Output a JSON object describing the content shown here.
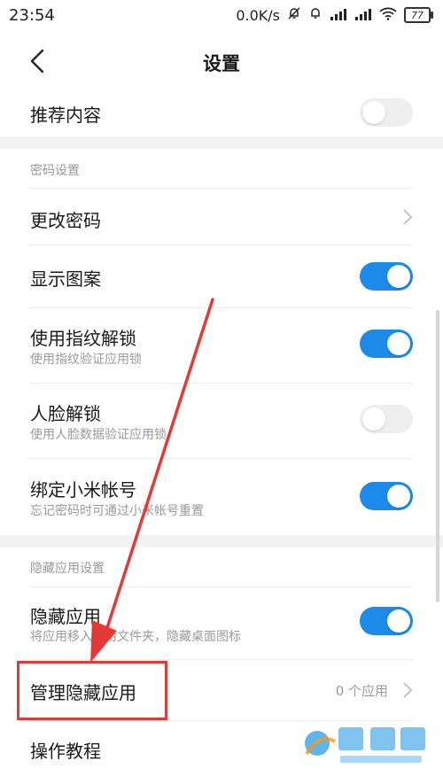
{
  "status_bar": {
    "time": "23:54",
    "speed": "0.0K/s",
    "battery": "77"
  },
  "header": {
    "title": "设置",
    "back_icon": "chevron-left-icon"
  },
  "rows": {
    "recommended": {
      "title": "推荐内容",
      "toggle": "off"
    },
    "password_section": {
      "header": "密码设置"
    },
    "change_password": {
      "title": "更改密码"
    },
    "show_pattern": {
      "title": "显示图案",
      "toggle": "on"
    },
    "fingerprint": {
      "title": "使用指纹解锁",
      "subtitle": "使用指纹验证应用锁",
      "toggle": "on"
    },
    "face_unlock": {
      "title": "人脸解锁",
      "subtitle": "使用人脸数据验证应用锁",
      "toggle": "off"
    },
    "mi_account": {
      "title": "绑定小米帐号",
      "subtitle": "忘记密码时可通过小米帐号重置",
      "toggle": "on"
    },
    "hidden_section": {
      "header": "隐藏应用设置"
    },
    "hide_apps": {
      "title": "隐藏应用",
      "subtitle": "将应用移入应用文件夹，隐藏桌面图标",
      "toggle": "on"
    },
    "manage_hidden": {
      "title": "管理隐藏应用",
      "value": "0 个应用"
    },
    "tutorial": {
      "title": "操作教程"
    }
  },
  "colors": {
    "accent": "#1b8ae8",
    "toggle_off": "#eeeeee",
    "annotation": "#e53935",
    "section_bg": "#f3f3f3"
  }
}
